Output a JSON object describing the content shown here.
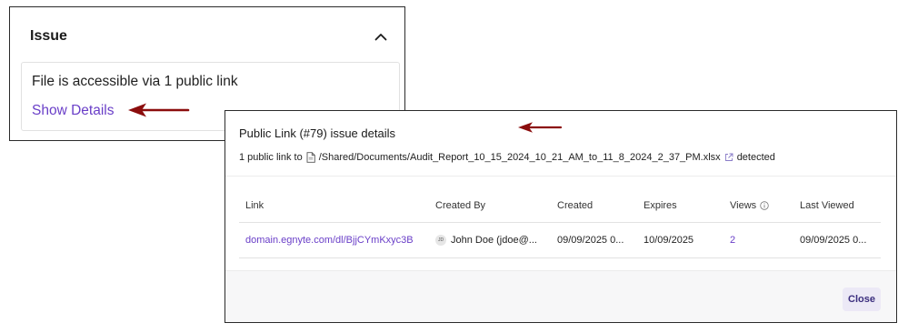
{
  "issue_panel": {
    "title": "Issue",
    "message": "File is accessible via 1 public link",
    "show_details_label": "Show Details"
  },
  "modal": {
    "title": "Public Link (#79) issue details",
    "subtitle_prefix": "1 public link to",
    "file_path": "/Shared/Documents/Audit_Report_10_15_2024_10_21_AM_to_11_8_2024_2_37_PM.xlsx",
    "subtitle_suffix": "detected",
    "table": {
      "headers": [
        "Link",
        "Created By",
        "Created",
        "Expires",
        "Views",
        "Last Viewed"
      ],
      "rows": [
        {
          "link": "domain.egnyte.com/dl/BjjCYmKxyc3B",
          "avatar_initials": "JD",
          "created_by": "John Doe (jdoe@...",
          "created": "09/09/2025 0...",
          "expires": "10/09/2025",
          "views": "2",
          "last_viewed": "09/09/2025 0..."
        }
      ]
    },
    "close_label": "Close"
  },
  "colors": {
    "accent": "#6a3fc8",
    "arrow": "#8b0d0d",
    "close_bg": "#ece9f6"
  }
}
